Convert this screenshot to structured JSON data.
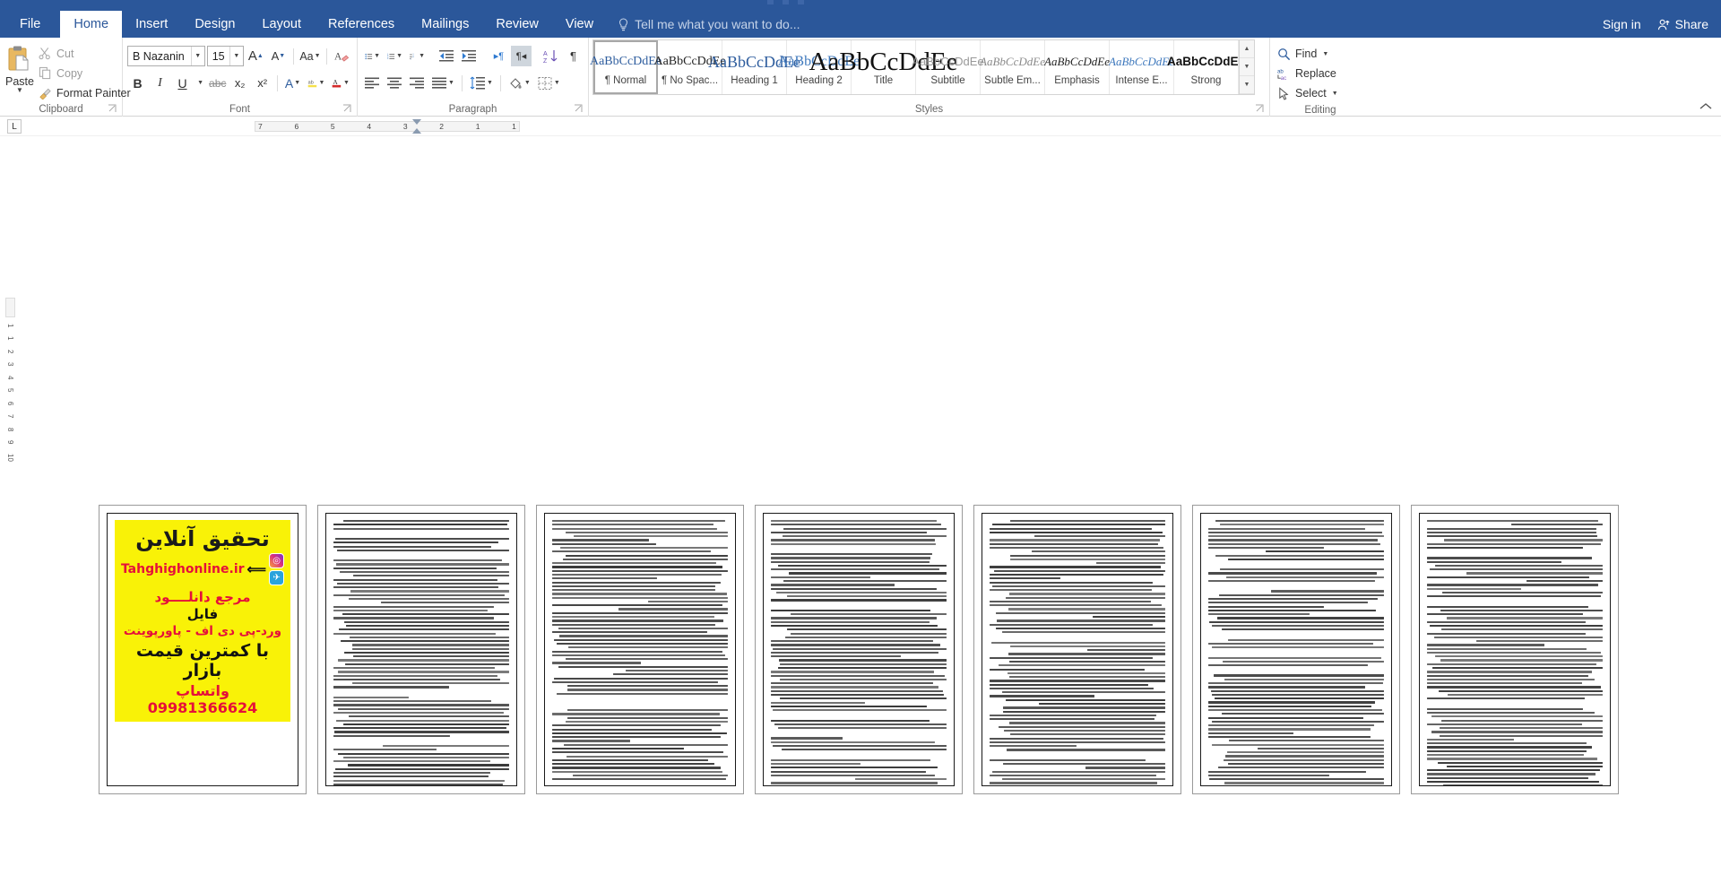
{
  "titlebar": {
    "tabs": [
      {
        "label": "File",
        "active": false
      },
      {
        "label": "Home",
        "active": true
      },
      {
        "label": "Insert",
        "active": false
      },
      {
        "label": "Design",
        "active": false
      },
      {
        "label": "Layout",
        "active": false
      },
      {
        "label": "References",
        "active": false
      },
      {
        "label": "Mailings",
        "active": false
      },
      {
        "label": "Review",
        "active": false
      },
      {
        "label": "View",
        "active": false
      }
    ],
    "tellme_placeholder": "Tell me what you want to do...",
    "signin": "Sign in",
    "share": "Share"
  },
  "ribbon": {
    "clipboard": {
      "label": "Clipboard",
      "paste": "Paste",
      "cut": "Cut",
      "copy": "Copy",
      "format_painter": "Format Painter"
    },
    "font": {
      "label": "Font",
      "font_name": "B Nazanin",
      "font_size": "15",
      "grow_font": "A",
      "shrink_font": "A",
      "change_case": "Aa",
      "clear_formatting": "A",
      "bold": "B",
      "italic": "I",
      "underline": "U",
      "strikethrough": "abc",
      "subscript": "x₂",
      "superscript": "x²",
      "text_effects": "A",
      "highlight": "ab",
      "font_color": "A"
    },
    "paragraph": {
      "label": "Paragraph",
      "bullets": "•",
      "numbering": "1.",
      "multilevel": "a",
      "decrease_indent": "←",
      "increase_indent": "→",
      "ltr_text": "▸¶",
      "rtl_text": "¶◂",
      "sort": "AZ",
      "show_marks": "¶",
      "align_left": "≡",
      "align_center": "≡",
      "align_right": "≡",
      "justify": "≡",
      "line_spacing": "↕",
      "shading": "□",
      "borders": "⊞"
    },
    "styles": {
      "label": "Styles",
      "items": [
        {
          "preview": "AaBbCcDdEe",
          "name": "¶ Normal",
          "selected": true
        },
        {
          "preview": "AaBbCcDdEe",
          "name": "¶ No Spac...",
          "selected": false
        },
        {
          "preview": "AaBbCcDdEe",
          "name": "Heading 1",
          "selected": false
        },
        {
          "preview": "AaBbCcDdEe",
          "name": "Heading 2",
          "selected": false
        },
        {
          "preview": "AaBbCcDdEe",
          "name": "Title",
          "selected": false
        },
        {
          "preview": "AaBbCcDdEe",
          "name": "Subtitle",
          "selected": false
        },
        {
          "preview": "AaBbCcDdEe",
          "name": "Subtle Em...",
          "selected": false
        },
        {
          "preview": "AaBbCcDdEe",
          "name": "Emphasis",
          "selected": false
        },
        {
          "preview": "AaBbCcDdEe",
          "name": "Intense E...",
          "selected": false
        },
        {
          "preview": "AaBbCcDdEe",
          "name": "Strong",
          "selected": false
        }
      ]
    },
    "editing": {
      "label": "Editing",
      "find": "Find",
      "replace": "Replace",
      "select": "Select"
    }
  },
  "ruler": {
    "tab_selector": "L",
    "marks": [
      "7",
      "6",
      "5",
      "4",
      "3",
      "2",
      "1",
      "1"
    ],
    "vertical_marks": [
      "1",
      "1",
      "2",
      "3",
      "4",
      "5",
      "6",
      "7",
      "8",
      "9",
      "10"
    ]
  },
  "document": {
    "ad": {
      "title": "تحقیق آنلاین",
      "url": "Tahghighonline.ir",
      "line2": "مرجع دانلــــود",
      "line3": "فایل",
      "line4": "ورد-پی دی اف - پاورپوینت",
      "line5": "با کمترین قیمت بازار",
      "line6": "واتساپ 09981366624",
      "bg_color": "#f9f207",
      "accent_color": "#e5103a"
    },
    "page_count": 7
  },
  "colors": {
    "ribbon_blue": "#2b579a",
    "accent": "#2e5d9e"
  }
}
